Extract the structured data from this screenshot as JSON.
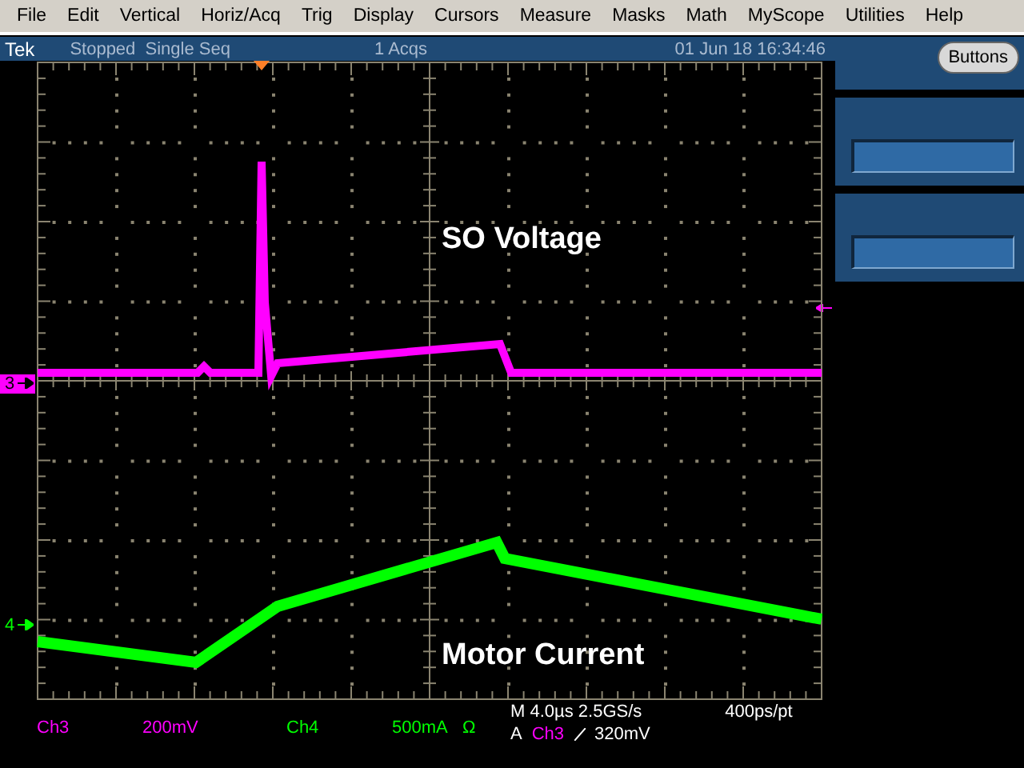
{
  "menu": [
    "File",
    "Edit",
    "Vertical",
    "Horiz/Acq",
    "Trig",
    "Display",
    "Cursors",
    "Measure",
    "Masks",
    "Math",
    "MyScope",
    "Utilities",
    "Help"
  ],
  "status_bar": {
    "brand": "Tek",
    "state": "Stopped  Single Seq",
    "acquisitions": "1 Acqs",
    "timestamp": "01 Jun 18 16:34:46"
  },
  "side_panel": {
    "button": "Buttons"
  },
  "traces": [
    {
      "marker": "3",
      "label": "SO Voltage",
      "color": "#ff00ff"
    },
    {
      "marker": "4",
      "label": "Motor Current",
      "color": "#00ff00"
    }
  ],
  "readouts": {
    "channels": [
      {
        "name": "Ch3",
        "scale": "200mV",
        "color": "#ff00ff"
      },
      {
        "name": "Ch4",
        "scale": "500mA",
        "unit": "Ω",
        "color": "#00ff00"
      }
    ],
    "timebase": "M 4.0µs 2.5GS/s",
    "resolution": "400ps/pt",
    "trigger": {
      "mode": "A",
      "source": "Ch3",
      "level": "320mV",
      "color": "#ff00ff"
    }
  }
}
